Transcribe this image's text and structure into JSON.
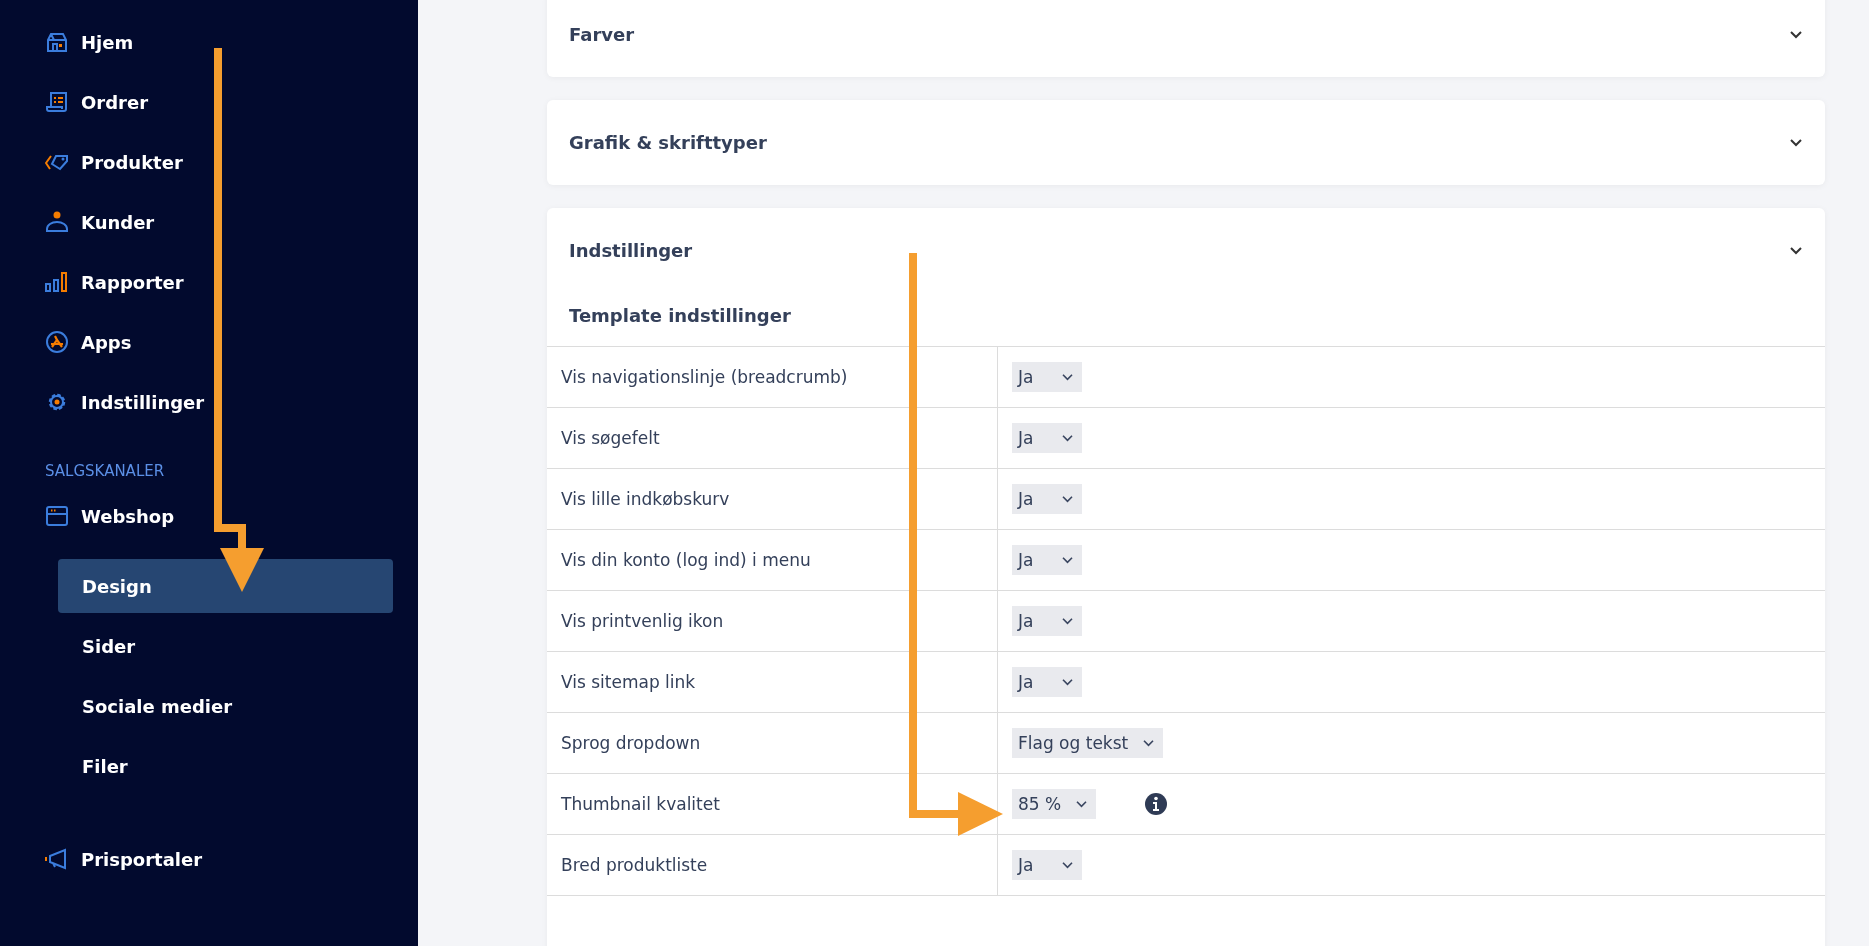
{
  "sidebar": {
    "nav_items": [
      {
        "label": "Hjem"
      },
      {
        "label": "Ordrer"
      },
      {
        "label": "Produkter"
      },
      {
        "label": "Kunder"
      },
      {
        "label": "Rapporter"
      },
      {
        "label": "Apps"
      },
      {
        "label": "Indstillinger"
      }
    ],
    "section_label": "SALGSKANALER",
    "channel": {
      "label": "Webshop"
    },
    "sub_items": [
      {
        "label": "Design",
        "selected": true
      },
      {
        "label": "Sider",
        "selected": false
      },
      {
        "label": "Sociale medier",
        "selected": false
      },
      {
        "label": "Filer",
        "selected": false
      }
    ],
    "bottom_item": {
      "label": "Prisportaler"
    }
  },
  "panels": [
    {
      "title": "Farver"
    },
    {
      "title": "Grafik & skrifttyper"
    },
    {
      "title": "Indstillinger",
      "subtitle": "Template indstillinger",
      "rows": [
        {
          "label": "Vis navigationslinje (breadcrumb)",
          "value": "Ja",
          "info": false
        },
        {
          "label": "Vis søgefelt",
          "value": "Ja",
          "info": false
        },
        {
          "label": "Vis lille indkøbskurv",
          "value": "Ja",
          "info": false
        },
        {
          "label": "Vis din konto (log ind) i menu",
          "value": "Ja",
          "info": false
        },
        {
          "label": "Vis printvenlig ikon",
          "value": "Ja",
          "info": false
        },
        {
          "label": "Vis sitemap link",
          "value": "Ja",
          "info": false
        },
        {
          "label": "Sprog dropdown",
          "value": "Flag og tekst",
          "info": false
        },
        {
          "label": "Thumbnail kvalitet",
          "value": "85 %",
          "info": true
        },
        {
          "label": "Bred produktliste",
          "value": "Ja",
          "info": false
        }
      ]
    }
  ]
}
